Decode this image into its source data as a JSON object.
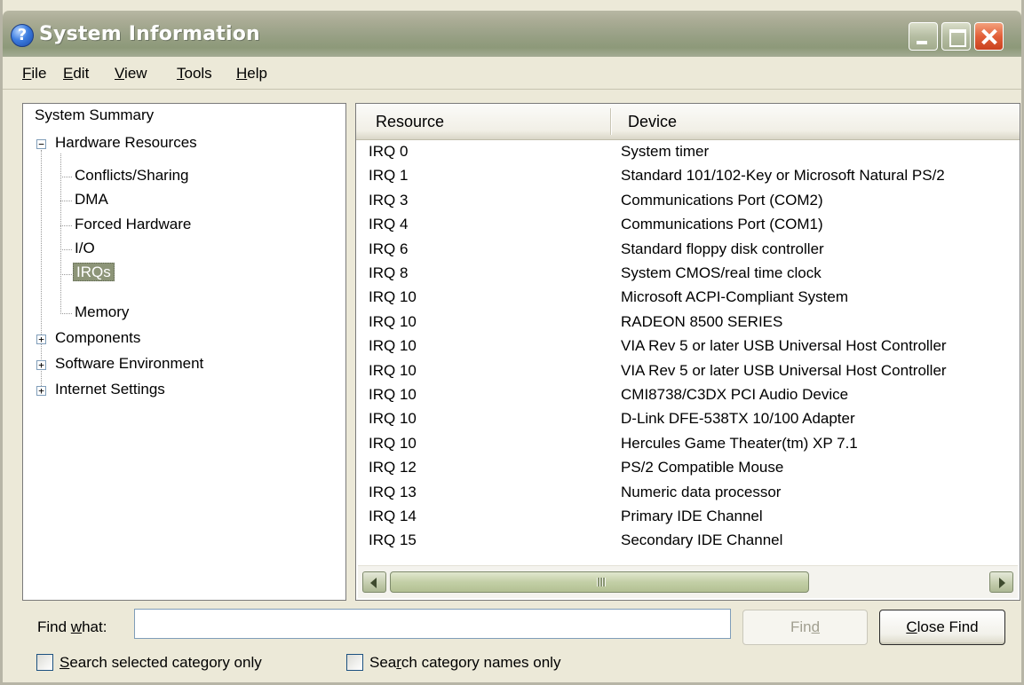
{
  "window": {
    "title": "System Information",
    "app_icon": "help-question-icon",
    "controls": [
      "minimize",
      "maximize",
      "close"
    ]
  },
  "menu": [
    {
      "pre": "",
      "acc": "F",
      "post": "ile"
    },
    {
      "pre": "",
      "acc": "E",
      "post": "dit"
    },
    {
      "pre": "",
      "acc": "V",
      "post": "iew"
    },
    {
      "pre": "",
      "acc": "T",
      "post": "ools"
    },
    {
      "pre": "",
      "acc": "H",
      "post": "elp"
    }
  ],
  "tree": {
    "root": "System Summary",
    "hardware_resources": "Hardware Resources",
    "children": [
      "Conflicts/Sharing",
      "DMA",
      "Forced Hardware",
      "I/O",
      "IRQs",
      "Memory"
    ],
    "selected": "IRQs",
    "components": "Components",
    "software_environment": "Software Environment",
    "internet_settings": "Internet Settings"
  },
  "list": {
    "columns": [
      "Resource",
      "Device"
    ],
    "rows": [
      [
        "IRQ 0",
        "System timer"
      ],
      [
        "IRQ 1",
        "Standard 101/102-Key or Microsoft Natural PS/2"
      ],
      [
        "IRQ 3",
        "Communications Port (COM2)"
      ],
      [
        "IRQ 4",
        "Communications Port (COM1)"
      ],
      [
        "IRQ 6",
        "Standard floppy disk controller"
      ],
      [
        "IRQ 8",
        "System CMOS/real time clock"
      ],
      [
        "IRQ 10",
        "Microsoft ACPI-Compliant System"
      ],
      [
        "IRQ 10",
        "RADEON 8500 SERIES"
      ],
      [
        "IRQ 10",
        "VIA Rev 5 or later USB Universal Host Controller"
      ],
      [
        "IRQ 10",
        "VIA Rev 5 or later USB Universal Host Controller"
      ],
      [
        "IRQ 10",
        "CMI8738/C3DX PCI Audio Device"
      ],
      [
        "IRQ 10",
        "D-Link DFE-538TX 10/100 Adapter"
      ],
      [
        "IRQ 10",
        "Hercules Game Theater(tm) XP 7.1"
      ],
      [
        "IRQ 12",
        "PS/2 Compatible Mouse"
      ],
      [
        "IRQ 13",
        "Numeric data processor"
      ],
      [
        "IRQ 14",
        "Primary IDE Channel"
      ],
      [
        "IRQ 15",
        "Secondary IDE Channel"
      ]
    ]
  },
  "find": {
    "label_pre": "Find ",
    "label_acc": "w",
    "label_post": "hat:",
    "value": "",
    "find_button": {
      "pre": "Fin",
      "acc": "d",
      "post": "",
      "enabled": false
    },
    "close_button": {
      "pre": "",
      "acc": "C",
      "post": "lose Find"
    },
    "search_selected": {
      "pre": "",
      "acc": "S",
      "post": "earch selected category only",
      "checked": false
    },
    "search_names": {
      "pre": "Sea",
      "acc": "r",
      "post": "ch category names only",
      "checked": false
    }
  },
  "colors": {
    "titlebar": "#98a085",
    "selection": "#8d9578",
    "window_face": "#ece9d8"
  }
}
